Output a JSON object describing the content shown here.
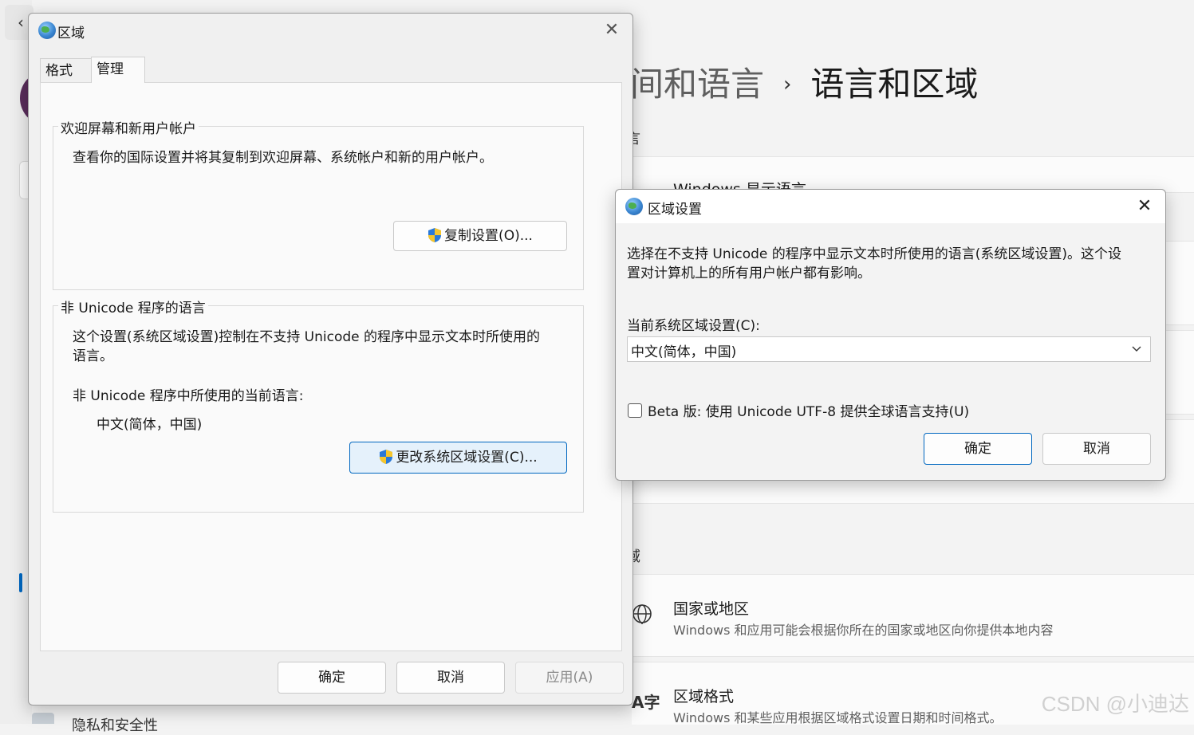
{
  "background_app": {
    "breadcrumb_parent": "间和语言",
    "breadcrumb_separator": "›",
    "breadcrumb_current": "语言和区域",
    "section_language_fragment": "言",
    "card_display_language": "Windows 显示语言",
    "section_region_fragment": "域",
    "card_country": {
      "title": "国家或地区",
      "subtitle": "Windows 和应用可能会根据你所在的国家或地区向你提供本地内容",
      "icon": "globe-icon"
    },
    "card_region_format": {
      "title": "区域格式",
      "subtitle": "Windows 和某些应用根据区域格式设置日期和时间格式。",
      "icon": "language-format-icon"
    },
    "sidebar_bottom_item": "隐私和安全性",
    "watermark": "CSDN @小迪达"
  },
  "region_dialog": {
    "title": "区域",
    "close_label": "✕",
    "tabs": [
      {
        "label": "格式"
      },
      {
        "label": "管理"
      }
    ],
    "welcome_group": {
      "legend": "欢迎屏幕和新用户帐户",
      "description": "查看你的国际设置并将其复制到欢迎屏幕、系统帐户和新的用户帐户。",
      "copy_button": "复制设置(O)..."
    },
    "unicode_group": {
      "legend": "非 Unicode 程序的语言",
      "description_line1": "这个设置(系统区域设置)控制在不支持 Unicode 的程序中显示文本时所使用的",
      "description_line2": "语言。",
      "current_label": "非 Unicode 程序中所使用的当前语言:",
      "current_value": "中文(简体，中国)",
      "change_button": "更改系统区域设置(C)..."
    },
    "footer": {
      "ok": "确定",
      "cancel": "取消",
      "apply": "应用(A)"
    }
  },
  "region_settings_dialog": {
    "title": "区域设置",
    "close_label": "✕",
    "description_line1": "选择在不支持 Unicode 的程序中显示文本时所使用的语言(系统区域设置)。这个设",
    "description_line2": "置对计算机上的所有用户帐户都有影响。",
    "current_label": "当前系统区域设置(C):",
    "current_value": "中文(简体，中国)",
    "beta_checkbox_label": "Beta 版: 使用 Unicode UTF-8 提供全球语言支持(U)",
    "beta_checked": false,
    "ok": "确定",
    "cancel": "取消"
  },
  "colors": {
    "accent": "#0067c0",
    "dialog_bg": "#f0f0f0",
    "panel_bg": "#fafafa"
  }
}
